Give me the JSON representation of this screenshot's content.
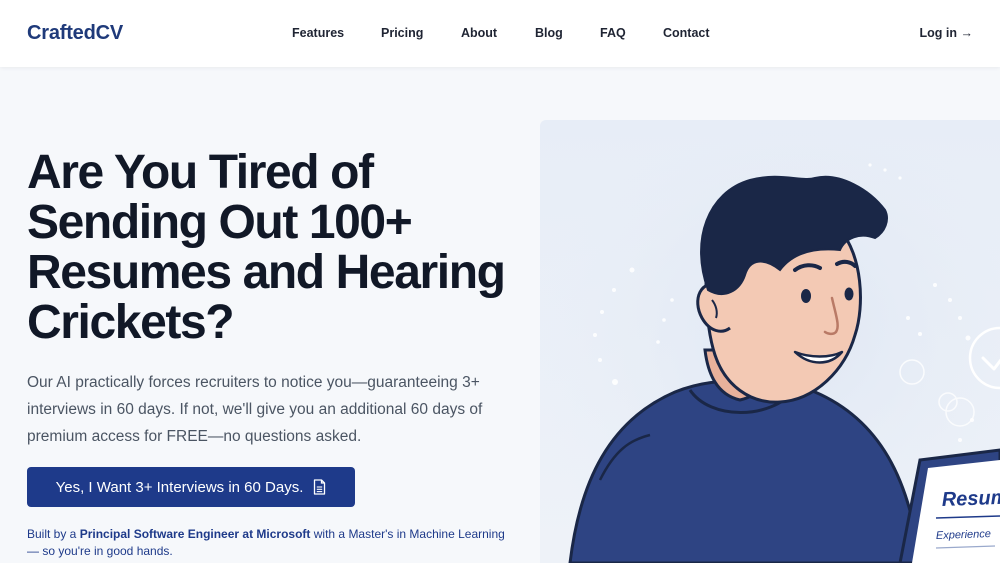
{
  "brand": {
    "name": "CraftedCV",
    "color": "#1f3a7a"
  },
  "nav": {
    "links": [
      "Features",
      "Pricing",
      "About",
      "Blog",
      "FAQ",
      "Contact"
    ],
    "login": "Log in →"
  },
  "hero": {
    "title": "Are You Tired of Sending Out 100+ Resumes and Hearing Crickets?",
    "subtitle": "Our AI practically forces recruiters to notice you—guaranteeing 3+ interviews in 60 days. If not, we'll give you an additional 60 days of premium access for FREE—no questions asked.",
    "cta": "Yes, I Want 3+ Interviews in 60 Days.",
    "cta_icon": "document-icon",
    "credit": {
      "prefix": "Built by a ",
      "highlight": "Principal Software Engineer at Microsoft",
      "suffix": " with a Master's in Machine Learning— so you're in good hands."
    }
  },
  "illustration": {
    "resume_title": "Resum",
    "resume_section": "Experience",
    "colors": {
      "shirt": "#2e4483",
      "hair": "#1a2747",
      "skin": "#f3c9b4",
      "accent": "#1e3a8a"
    }
  }
}
